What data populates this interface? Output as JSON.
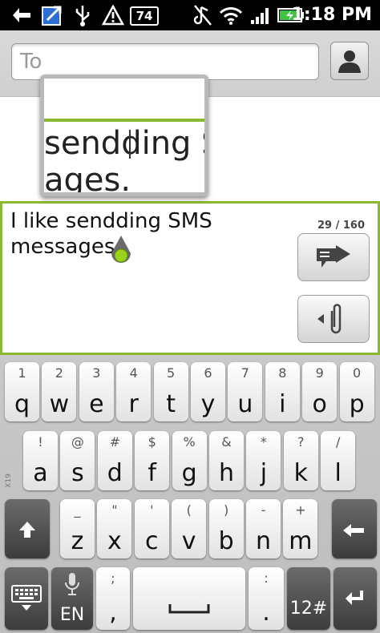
{
  "status_bar": {
    "battery_badge": "74",
    "time": "1:18",
    "time_suffix": "PM"
  },
  "recipient": {
    "placeholder": "To"
  },
  "magnifier": {
    "line1": "sendding S",
    "line2": "ages."
  },
  "compose": {
    "message": "I like sendding SMS messages.",
    "counter": "29 / 160"
  },
  "keyboard": {
    "row1": [
      {
        "hint": "1",
        "key": "q"
      },
      {
        "hint": "2",
        "key": "w"
      },
      {
        "hint": "3",
        "key": "e"
      },
      {
        "hint": "4",
        "key": "r"
      },
      {
        "hint": "5",
        "key": "t"
      },
      {
        "hint": "6",
        "key": "y"
      },
      {
        "hint": "7",
        "key": "u"
      },
      {
        "hint": "8",
        "key": "i"
      },
      {
        "hint": "9",
        "key": "o"
      },
      {
        "hint": "0",
        "key": "p"
      }
    ],
    "row2": [
      {
        "hint": "!",
        "key": "a"
      },
      {
        "hint": "@",
        "key": "s"
      },
      {
        "hint": "#",
        "key": "d"
      },
      {
        "hint": "$",
        "key": "f"
      },
      {
        "hint": "%",
        "key": "g"
      },
      {
        "hint": "&",
        "key": "h"
      },
      {
        "hint": "*",
        "key": "j"
      },
      {
        "hint": "?",
        "key": "k"
      },
      {
        "hint": "/",
        "key": "l"
      }
    ],
    "row3": [
      {
        "hint": "_",
        "key": "z"
      },
      {
        "hint": "\"",
        "key": "x"
      },
      {
        "hint": "'",
        "key": "c"
      },
      {
        "hint": "(",
        "key": "v"
      },
      {
        "hint": ")",
        "key": "b"
      },
      {
        "hint": "-",
        "key": "n"
      },
      {
        "hint": "+",
        "key": "m"
      }
    ],
    "lang": "EN",
    "comma_hint": ";",
    "comma": ",",
    "period_hint": ":",
    "period": ".",
    "symbols": "12#",
    "side_label": "X19"
  }
}
